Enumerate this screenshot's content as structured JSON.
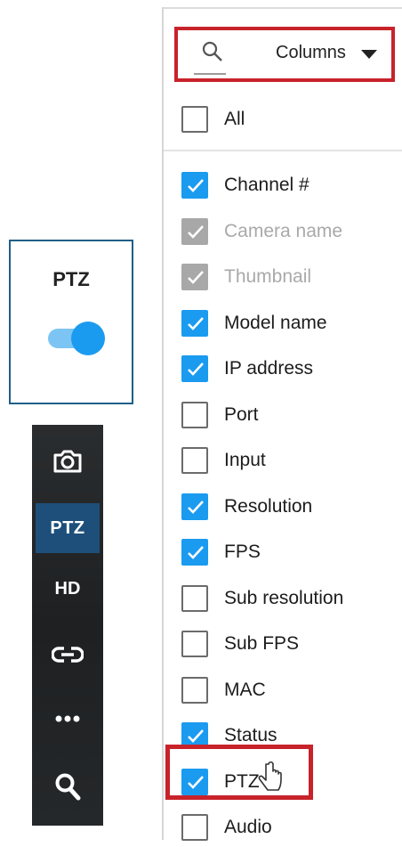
{
  "ptz_card": {
    "title": "PTZ",
    "toggle_on": true,
    "accent": "#1a9bf0"
  },
  "toolbar": {
    "items": [
      {
        "icon": "camera-icon",
        "label": ""
      },
      {
        "icon": "",
        "label": "PTZ",
        "active": true
      },
      {
        "icon": "",
        "label": "HD"
      },
      {
        "icon": "link-icon",
        "label": ""
      },
      {
        "icon": "more-icon",
        "label": ""
      },
      {
        "icon": "search-icon",
        "label": ""
      }
    ]
  },
  "columns_panel": {
    "search_icon": "search-icon",
    "dropdown_label": "Columns",
    "all_label": "All",
    "items": [
      {
        "label": "Channel #",
        "state": "checked"
      },
      {
        "label": "Camera name",
        "state": "disabled"
      },
      {
        "label": "Thumbnail",
        "state": "disabled"
      },
      {
        "label": "Model name",
        "state": "checked"
      },
      {
        "label": "IP address",
        "state": "checked"
      },
      {
        "label": "Port",
        "state": "unchecked"
      },
      {
        "label": "Input",
        "state": "unchecked"
      },
      {
        "label": "Resolution",
        "state": "checked"
      },
      {
        "label": "FPS",
        "state": "checked"
      },
      {
        "label": "Sub resolution",
        "state": "unchecked"
      },
      {
        "label": "Sub FPS",
        "state": "unchecked"
      },
      {
        "label": "MAC",
        "state": "unchecked"
      },
      {
        "label": "Status",
        "state": "checked"
      },
      {
        "label": "PTZ",
        "state": "checked"
      },
      {
        "label": "Audio",
        "state": "unchecked"
      }
    ]
  },
  "colors": {
    "checked": "#1a9bf0",
    "disabled": "#a8a8a8",
    "highlight": "#c8222a"
  }
}
